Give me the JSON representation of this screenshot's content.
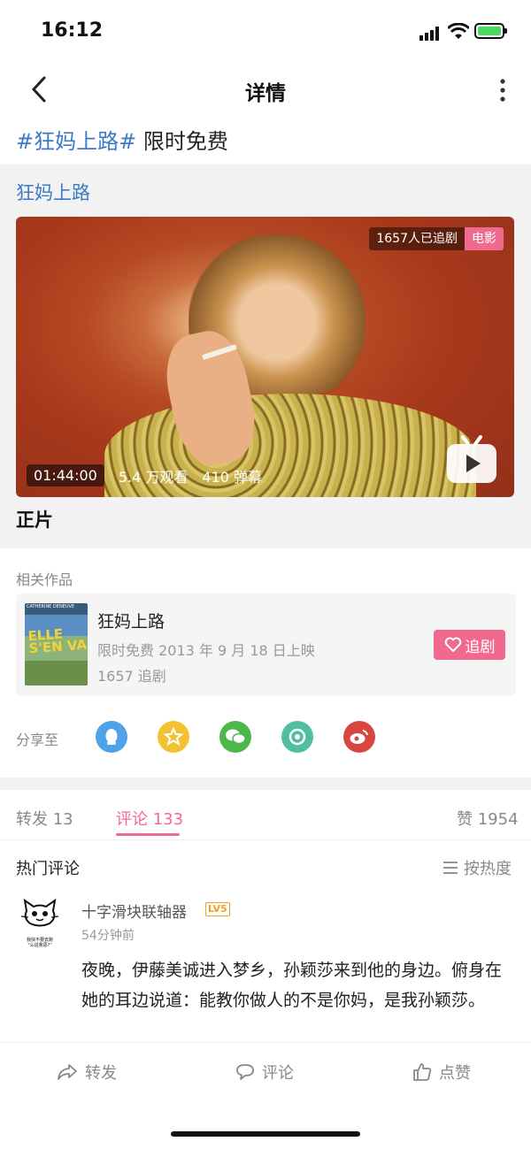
{
  "status": {
    "time": "16:12"
  },
  "nav": {
    "title": "详情"
  },
  "topic": {
    "hashtag": "#狂妈上路#",
    "text": "限时免费"
  },
  "card": {
    "title": "狂妈上路",
    "follow_badge": "1657人已追剧",
    "type_badge": "电影",
    "duration": "01:44:00",
    "views": "5.4 万观看",
    "danmaku": "410 弹幕",
    "episode": "正片"
  },
  "related": {
    "label": "相关作品",
    "poster_text": "ELLE S'EN VA",
    "poster_top": "CATHERINE DENEUVE",
    "title": "狂妈上路",
    "subtitle": "限时免费 2013 年 9 月 18 日上映",
    "count": "1657 追剧",
    "follow_button": "追剧"
  },
  "share": {
    "label": "分享至",
    "targets": [
      {
        "name": "qq-icon",
        "color": "#4ea3e8"
      },
      {
        "name": "qzone-icon",
        "color": "#f2c233"
      },
      {
        "name": "wechat-icon",
        "color": "#4cb84a"
      },
      {
        "name": "moments-icon",
        "color": "#4fbfa0"
      },
      {
        "name": "weibo-icon",
        "color": "#d9463f"
      }
    ]
  },
  "tabs": {
    "repost": "转发 13",
    "comments": "评论 133",
    "likes": "赞 1954"
  },
  "comments": {
    "section_label": "热门评论",
    "sort_label": "按热度",
    "items": [
      {
        "user": "十字滑块联轴器",
        "level": "LV5",
        "time": "54分钟前",
        "body": "夜晚，伊藤美诚进入梦乡，孙颖莎来到他的身边。俯身在她的耳边说道：能教你做人的不是你妈，是我孙颖莎。",
        "avatar_caption": "我快不要去跑\n\"么说我思?\""
      }
    ]
  },
  "bottom": {
    "repost": "转发",
    "comment": "评论",
    "like": "点赞"
  },
  "colors": {
    "accent": "#f06a8f",
    "link": "#3b7ac5"
  }
}
